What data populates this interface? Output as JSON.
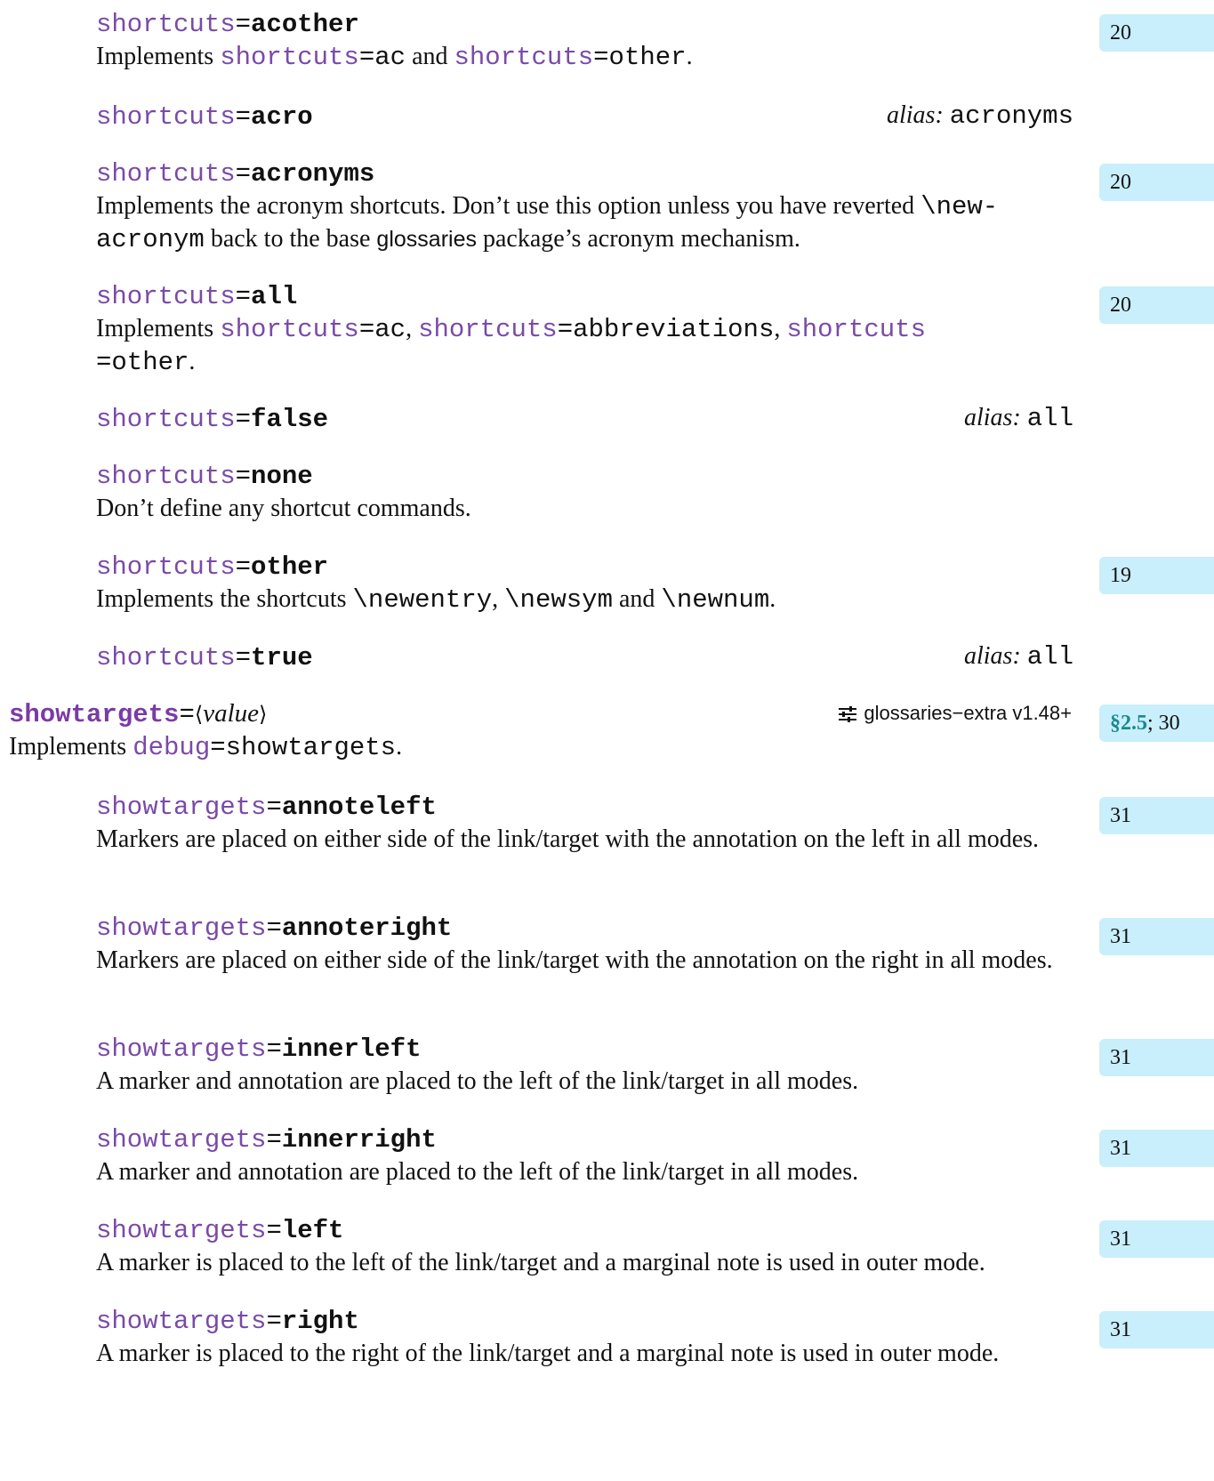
{
  "entries": [
    {
      "key": "shortcuts",
      "value": "acother",
      "ref": "20",
      "desc_parts": [
        "Implements ",
        "shortcuts",
        "=ac",
        " and ",
        "shortcuts",
        "=other",
        "."
      ]
    },
    {
      "key": "shortcuts",
      "value": "acro",
      "alias_label": "alias:",
      "alias_value": "acronyms"
    },
    {
      "key": "shortcuts",
      "value": "acronyms",
      "ref": "20",
      "desc_line1_a": "Implements the acronym shortcuts. Don’t use this option unless you have reverted ",
      "desc_line1_code": "\\new-",
      "desc_line2_code": "acronym",
      "desc_line2_a": " back to the base ",
      "desc_line2_pkg": "glossaries",
      "desc_line2_b": " package’s acronym mechanism."
    },
    {
      "key": "shortcuts",
      "value": "all",
      "ref": "20",
      "desc_parts": [
        "Implements ",
        "shortcuts",
        "=ac",
        ", ",
        "shortcuts",
        "=abbreviations",
        ", ",
        "shortcuts",
        "=other",
        "."
      ]
    },
    {
      "key": "shortcuts",
      "value": "false",
      "alias_label": "alias:",
      "alias_value": "all"
    },
    {
      "key": "shortcuts",
      "value": "none",
      "desc": "Don’t define any shortcut commands."
    },
    {
      "key": "shortcuts",
      "value": "other",
      "ref": "19",
      "desc_parts": [
        "Implements the shortcuts ",
        "\\newentry",
        ", ",
        "\\newsym",
        " and ",
        "\\newnum",
        "."
      ]
    },
    {
      "key": "shortcuts",
      "value": "true",
      "alias_label": "alias:",
      "alias_value": "all"
    }
  ],
  "top": {
    "key": "showtargets",
    "eq": "=",
    "arg": "value",
    "pkg": "glossaries−extra v1.48+",
    "ref_sec": "§2.5",
    "ref_rest": "; 30",
    "desc_a": "Implements ",
    "desc_link": "debug",
    "desc_b": "=showtargets",
    "desc_c": ".",
    "icon": "options-sliders-icon"
  },
  "sub": [
    {
      "key": "showtargets",
      "value": "annoteleft",
      "ref": "31",
      "desc": "Markers are placed on either side of the link/target with the annotation on the left in all modes."
    },
    {
      "key": "showtargets",
      "value": "annoteright",
      "ref": "31",
      "desc": "Markers are placed on either side of the link/target with the annotation on the right in all modes."
    },
    {
      "key": "showtargets",
      "value": "innerleft",
      "ref": "31",
      "desc": "A marker and annotation are placed to the left of the link/target in all modes."
    },
    {
      "key": "showtargets",
      "value": "innerright",
      "ref": "31",
      "desc": "A marker and annotation are placed to the left of the link/target in all modes."
    },
    {
      "key": "showtargets",
      "value": "left",
      "ref": "31",
      "desc": "A marker is placed to the left of the link/target and a marginal note is used in outer mode."
    },
    {
      "key": "showtargets",
      "value": "right",
      "ref": "31",
      "desc": "A marker is placed to the right of the link/target and a marginal note is used in outer mode."
    }
  ],
  "colors": {
    "key": "#7a4aa8",
    "ref_bg": "#c9eefc",
    "section_ref": "#1b8a8a"
  }
}
